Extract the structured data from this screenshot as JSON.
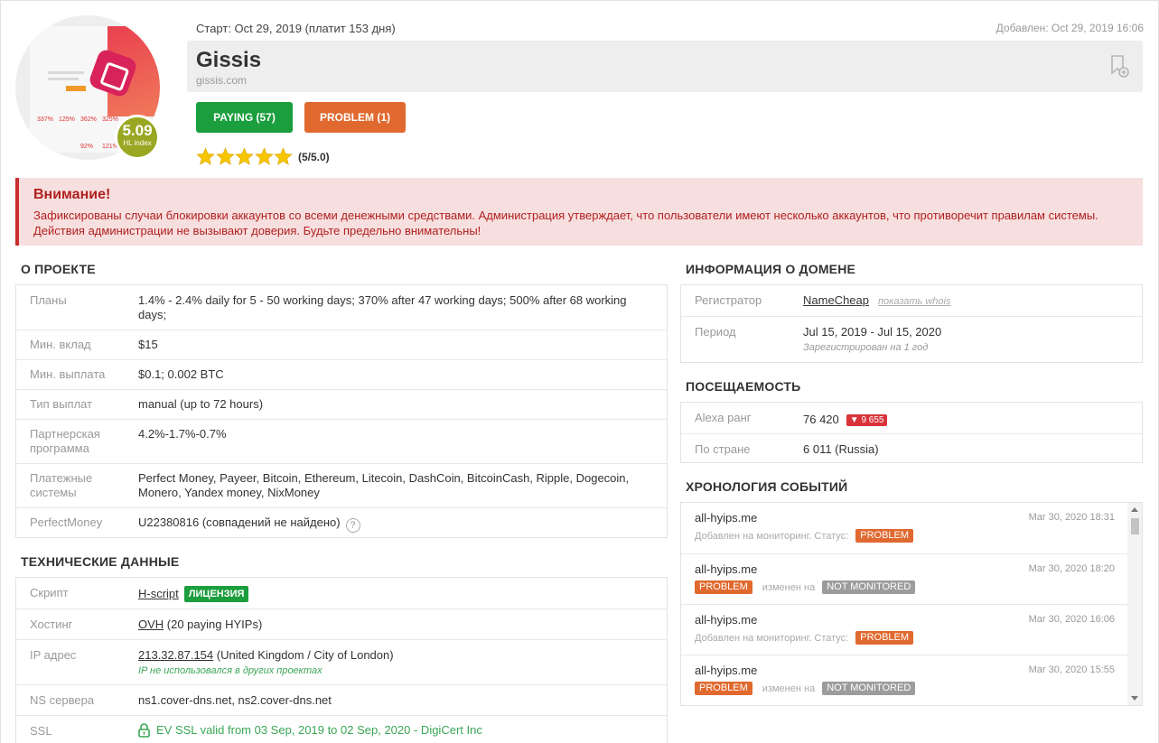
{
  "header": {
    "start": "Старт: Oct 29, 2019 (платит 153 дня)",
    "added": "Добавлен: Oct 29, 2019 16:06",
    "title": "Gissis",
    "domain": "gissis.com",
    "hl_value": "5.09",
    "hl_label": "HL index",
    "paying_label": "PAYING (57)",
    "problem_label": "PROBLEM (1)",
    "rating_text": "(5/5.0)",
    "rating_value": 5,
    "rating_max": 5,
    "thumb_stats": [
      "337%",
      "125%",
      "362%",
      "325%",
      "92%",
      "121%"
    ]
  },
  "warning": {
    "title": "Внимание!",
    "text": "Зафиксированы случаи блокировки аккаунтов со всеми денежными средствами. Администрация утверждает, что пользователи имеют несколько аккаунтов, что противоречит правилам системы. Действия администрации не вызывают доверия. Будьте предельно внимательны!"
  },
  "project": {
    "title": "О ПРОЕКТЕ",
    "plans_label": "Планы",
    "plans_value": "1.4% - 2.4% daily for 5 - 50 working days; 370% after 47 working days; 500% after 68 working days;",
    "min_deposit_label": "Мин. вклад",
    "min_deposit_value": "$15",
    "min_payout_label": "Мин. выплата",
    "min_payout_value": "$0.1; 0.002 BTC",
    "payout_type_label": "Тип выплат",
    "payout_type_value": "manual (up to 72 hours)",
    "referral_label": "Партнерская программа",
    "referral_value": "4.2%-1.7%-0.7%",
    "payments_label": "Платежные системы",
    "payments_value": "Perfect Money, Payeer, Bitcoin, Ethereum, Litecoin, DashCoin, BitcoinCash, Ripple, Dogecoin, Monero, Yandex money, NixMoney",
    "pm_label": "PerfectMoney",
    "pm_value": "U22380816 (совпадений не найдено)",
    "pm_help": "?"
  },
  "tech": {
    "title": "ТЕХНИЧЕСКИЕ ДАННЫЕ",
    "script_label": "Скрипт",
    "script_value": "H-script",
    "license_badge": "ЛИЦЕНЗИЯ",
    "hosting_label": "Хостинг",
    "hosting_value": "OVH",
    "hosting_extra": " (20 paying HYIPs)",
    "ip_label": "IP адрес",
    "ip_value": "213.32.87.154",
    "ip_extra": " (United Kingdom / City of London)",
    "ip_note": "IP не использовался в других проектах",
    "ns_label": "NS сервера",
    "ns_value": "ns1.cover-dns.net, ns2.cover-dns.net",
    "ssl_label": "SSL",
    "ssl_value": "EV SSL valid from 03 Sep, 2019 to 02 Sep, 2020 - DigiCert Inc"
  },
  "domain_info": {
    "title": "ИНФОРМАЦИЯ О ДОМЕНЕ",
    "registrar_label": "Регистратор",
    "registrar_value": "NameCheap",
    "whois_link": "показать whois",
    "period_label": "Период",
    "period_value": "Jul 15, 2019 - Jul 15, 2020",
    "period_note": "Зарегистрирован на 1 год"
  },
  "traffic": {
    "title": "ПОСЕЩАЕМОСТЬ",
    "alexa_label": "Alexa ранг",
    "alexa_value": "76 420",
    "alexa_delta": "▼ 9 655",
    "country_label": "По стране",
    "country_value": "6 011 (Russia)"
  },
  "timeline": {
    "title": "ХРОНОЛОГИЯ СОБЫТИЙ",
    "events": [
      {
        "source": "all-hyips.me",
        "date": "Mar 30, 2020 18:31",
        "prefix": "Добавлен на мониторинг. Статус:",
        "tag1": "PROBLEM",
        "middle": "",
        "tag2": ""
      },
      {
        "source": "all-hyips.me",
        "date": "Mar 30, 2020 18:20",
        "prefix": "",
        "tag1": "PROBLEM",
        "middle": "изменен на",
        "tag2": "NOT MONITORED"
      },
      {
        "source": "all-hyips.me",
        "date": "Mar 30, 2020 16:06",
        "prefix": "Добавлен на мониторинг. Статус:",
        "tag1": "PROBLEM",
        "middle": "",
        "tag2": ""
      },
      {
        "source": "all-hyips.me",
        "date": "Mar 30, 2020 15:55",
        "prefix": "",
        "tag1": "PROBLEM",
        "middle": "изменен на",
        "tag2": "NOT MONITORED"
      }
    ]
  },
  "colors": {
    "paying": "#1b9e3d",
    "problem": "#e0692f",
    "not_monitored": "#9c9c9c",
    "warning_bg": "#f8dfdf",
    "warning_text": "#b02020",
    "star": "#f7c600",
    "hl_badge": "#99a722"
  },
  "icons": {
    "bookmark": "bookmark-add-icon",
    "star": "star-icon",
    "help": "question-circle-icon",
    "lock": "lock-icon",
    "delta": "arrow-down-icon"
  }
}
